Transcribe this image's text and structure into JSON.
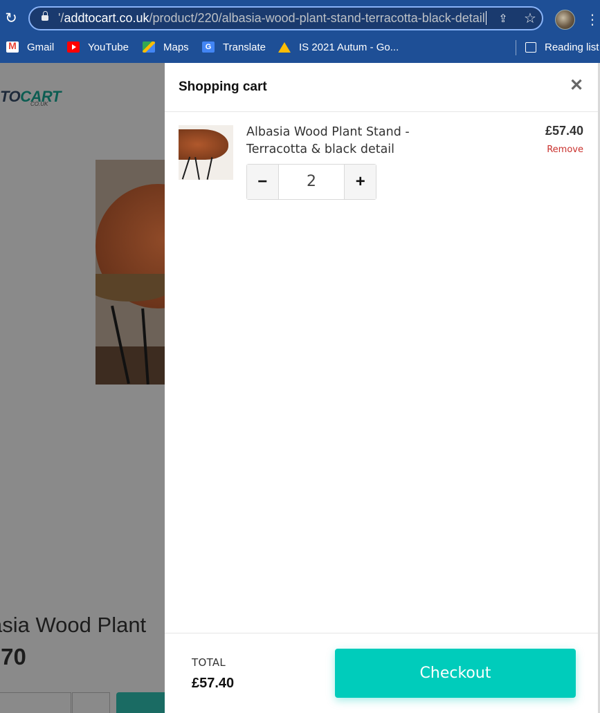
{
  "browser": {
    "url_prefix": "'/",
    "url_domain": "addtocart.co.uk",
    "url_path": "/product/220/albasia-wood-plant-stand-terracotta-black-detail",
    "bookmarks": [
      "Gmail",
      "YouTube",
      "Maps",
      "Translate",
      "IS 2021 Autum - Go..."
    ],
    "reading_list": "Reading list",
    "icons": [
      "reload-icon",
      "lock-icon",
      "share-icon",
      "star-icon",
      "profile-avatar",
      "more-menu-icon"
    ]
  },
  "background_page": {
    "logo_text": "TO",
    "logo_accent": "CART",
    "logo_sub": "CO.UK",
    "title_fragment": "asia Wood Plant",
    "price_fragment": ".70"
  },
  "cart": {
    "title": "Shopping cart",
    "close_symbol": "✕",
    "items": [
      {
        "name": "Albasia Wood Plant Stand - Terracotta & black detail",
        "price": "£57.40",
        "remove_label": "Remove",
        "quantity": "2",
        "decrement": "−",
        "increment": "+"
      }
    ],
    "total_label": "TOTAL",
    "total_value": "£57.40",
    "checkout_label": "Checkout"
  },
  "colors": {
    "chrome": "#1e4f96",
    "checkout": "#00ccbb",
    "remove": "#c9302c",
    "overlay_page": "#8a8a8a"
  }
}
